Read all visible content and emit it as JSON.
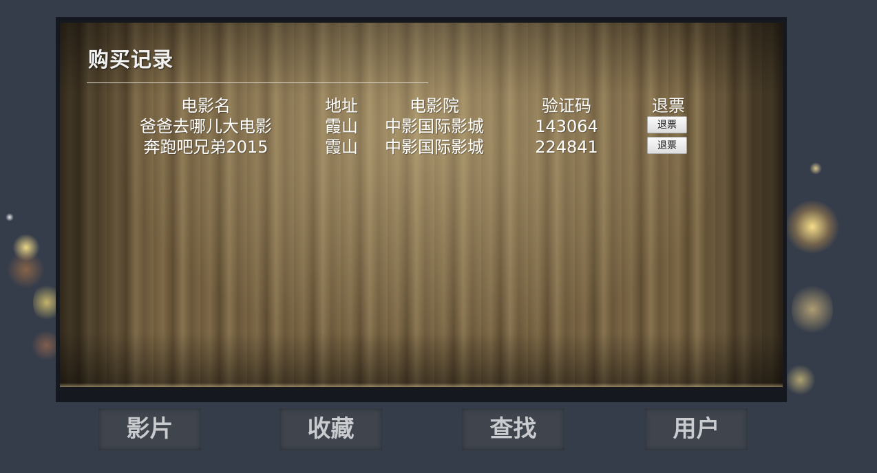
{
  "page": {
    "title": "购买记录"
  },
  "table": {
    "headers": [
      "电影名",
      "地址",
      "电影院",
      "验证码",
      "退票"
    ],
    "rows": [
      {
        "movie": "爸爸去哪儿大电影",
        "address": "霞山",
        "cinema": "中影国际影城",
        "code": "143064",
        "refund_label": "退票"
      },
      {
        "movie": "奔跑吧兄弟2015",
        "address": "霞山",
        "cinema": "中影国际影城",
        "code": "224841",
        "refund_label": "退票"
      }
    ]
  },
  "nav": {
    "items": [
      {
        "label": "影片"
      },
      {
        "label": "收藏"
      },
      {
        "label": "查找"
      },
      {
        "label": "用户"
      }
    ]
  }
}
